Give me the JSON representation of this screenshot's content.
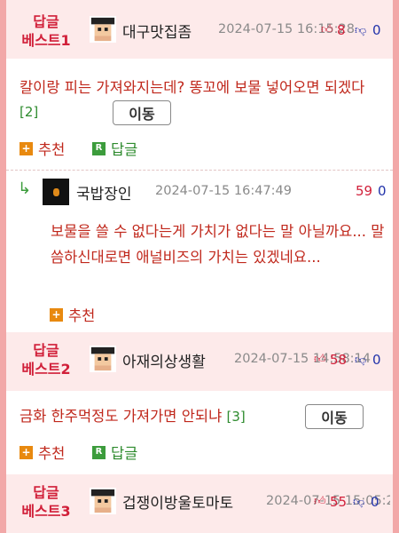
{
  "posts": [
    {
      "badge_line1": "답글",
      "badge_line2": "베스트1",
      "author": "대구맛집좀",
      "date": "2024-07-15 16:15:28",
      "up": "8",
      "down": "0",
      "body": "칼이랑 피는 가져와지는데? 똥꼬에 보물 넣어오면 되겠다",
      "replies": "[2]",
      "move_label": "이동",
      "recommend_label": "추천",
      "reply_label": "답글"
    },
    {
      "badge_line1": "답글",
      "badge_line2": "베스트2",
      "author": "아재의상생활",
      "date": "2024-07-15 14:58:14",
      "up": "58",
      "down": "0",
      "body": "금화 한주먹정도 가져가면 안되냐",
      "replies": "[3]",
      "move_label": "이동",
      "recommend_label": "추천",
      "reply_label": "답글"
    },
    {
      "badge_line1": "답글",
      "badge_line2": "베스트3",
      "author": "겁쟁이방울토마토",
      "date": "2024-07-15 15:05:22",
      "up": "55",
      "down": "0"
    }
  ],
  "subreply": {
    "author": "국밥장인",
    "date": "2024-07-15 16:47:49",
    "up": "59",
    "down": "0",
    "body": "보물을 쓸 수 없다는게 가치가 없다는 말 아닐까요... 말씀하신대로면 애널비즈의 가치는 있겠네요...",
    "recommend_label": "추천"
  },
  "icons": {
    "thumb_up": "thumb-up-icon",
    "thumb_down": "thumb-down-icon",
    "reply_arrow": "reply-arrow-icon"
  },
  "colors": {
    "best_label": "#d1203a",
    "header_bg": "#fdeaea",
    "frame": "#f2a8a8",
    "body_text": "#c0281c",
    "reply_green": "#2e8b2e"
  }
}
